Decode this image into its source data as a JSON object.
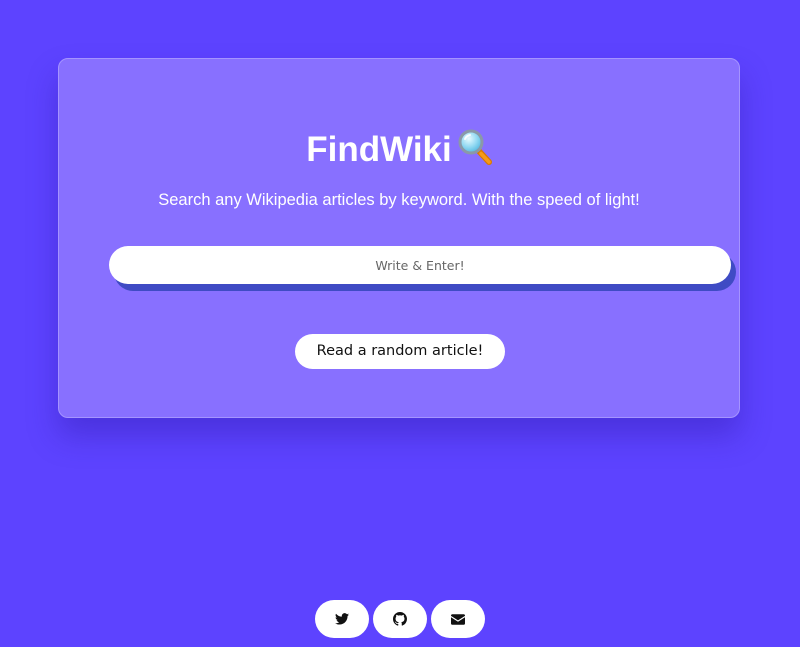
{
  "header": {
    "title": "FindWiki",
    "title_icon": "magnifying-glass-icon",
    "subtitle": "Search any Wikipedia articles by keyword. With the speed of light!"
  },
  "search": {
    "value": "",
    "placeholder": "Write & Enter!"
  },
  "random_button": {
    "label": "Read a random article!"
  },
  "footer": {
    "links": [
      {
        "icon": "twitter-icon"
      },
      {
        "icon": "github-icon"
      },
      {
        "icon": "envelope-icon"
      }
    ]
  },
  "colors": {
    "background": "#5d43ff",
    "card": "#8870ff",
    "input_shadow": "#3f4bc4",
    "text": "#ffffff"
  }
}
